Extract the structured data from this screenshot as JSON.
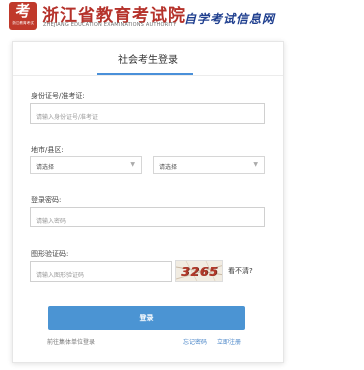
{
  "header": {
    "logo_badge_glyph": "考",
    "logo_badge_text": "浙江教育考试",
    "title": "浙江省教育考试院",
    "subtitle": "ZHEJIANG EDUCATION EXAMINATIONS AUTHORITY",
    "slogan": "自学考试信息网",
    "brand_color": "#b5322b",
    "slogan_color": "#1f3f8f"
  },
  "login": {
    "title": "社会考生登录",
    "id_label": "身份证号/准考证:",
    "id_placeholder": "请输入身份证号/准考证",
    "region_label": "地市/县区:",
    "city_value": "请选择",
    "district_value": "请选择",
    "password_label": "登录密码:",
    "password_placeholder": "请输入密码",
    "captcha_label": "图形验证码:",
    "captcha_placeholder": "请输入图形验证码",
    "captcha_code": "3265",
    "refresh_label": "看不清?",
    "submit_label": "登录",
    "group_link": "前往集体单位登录",
    "forgot_link": "忘记密码",
    "register_link": "立即注册",
    "accent_color": "#4b94d3"
  },
  "icons": {
    "dropdown": "chevron-down-icon"
  }
}
